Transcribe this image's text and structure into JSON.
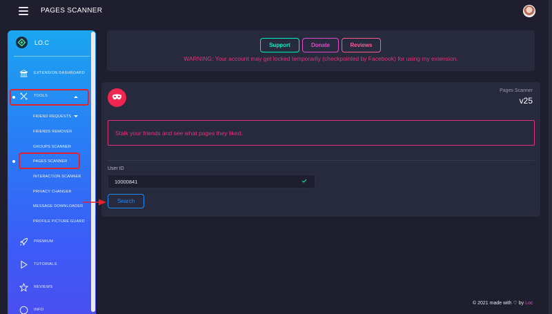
{
  "app": {
    "title": "PAGES SCANNER"
  },
  "sidebar": {
    "brand": "LO.C",
    "items": [
      {
        "label": "EXTENSION DASHBOARD",
        "icon": "bank-icon"
      },
      {
        "label": "TOOLS",
        "icon": "tools-icon"
      },
      {
        "label": "PREMIUM",
        "icon": "rocket-icon"
      },
      {
        "label": "TUTORIALS",
        "icon": "play-icon"
      },
      {
        "label": "REVIEWS",
        "icon": "star-icon"
      },
      {
        "label": "INFO",
        "icon": "info-icon"
      }
    ],
    "tools_sub": [
      {
        "label": "FRIEND REQUESTS"
      },
      {
        "label": "FRIENDS REMOVER"
      },
      {
        "label": "GROUPS SCANNER"
      },
      {
        "label": "PAGES SCANNER"
      },
      {
        "label": "INTERACTION SCANNER"
      },
      {
        "label": "PRIVACY CHANGER"
      },
      {
        "label": "MESSAGE DOWNLOADER"
      },
      {
        "label": "PROFILE PICTURE GUARD"
      }
    ]
  },
  "top_card": {
    "buttons": [
      {
        "label": "Support",
        "color": "#00f2c3"
      },
      {
        "label": "Donate",
        "color": "#e14eca"
      },
      {
        "label": "Reviews",
        "color": "#fd5d93"
      }
    ],
    "warning": "WARNING: Your account may get locked temporarily (checkpointed by Facebook) for using my extension."
  },
  "scanner": {
    "label": "Pages Scanner",
    "version": "v25",
    "description": "Stalk your friends and see what pages they liked.",
    "field_label": "User ID",
    "field_value": "10000841",
    "search_label": "Search"
  },
  "footer": {
    "prefix": "© 2021 made with",
    "by": "by",
    "author": "Loc"
  },
  "colors": {
    "background": "#1e1e2f",
    "card": "#27293d",
    "accent_pink": "#e2367a",
    "accent_blue": "#1d8cf8",
    "annotation_red": "#e8202a"
  }
}
